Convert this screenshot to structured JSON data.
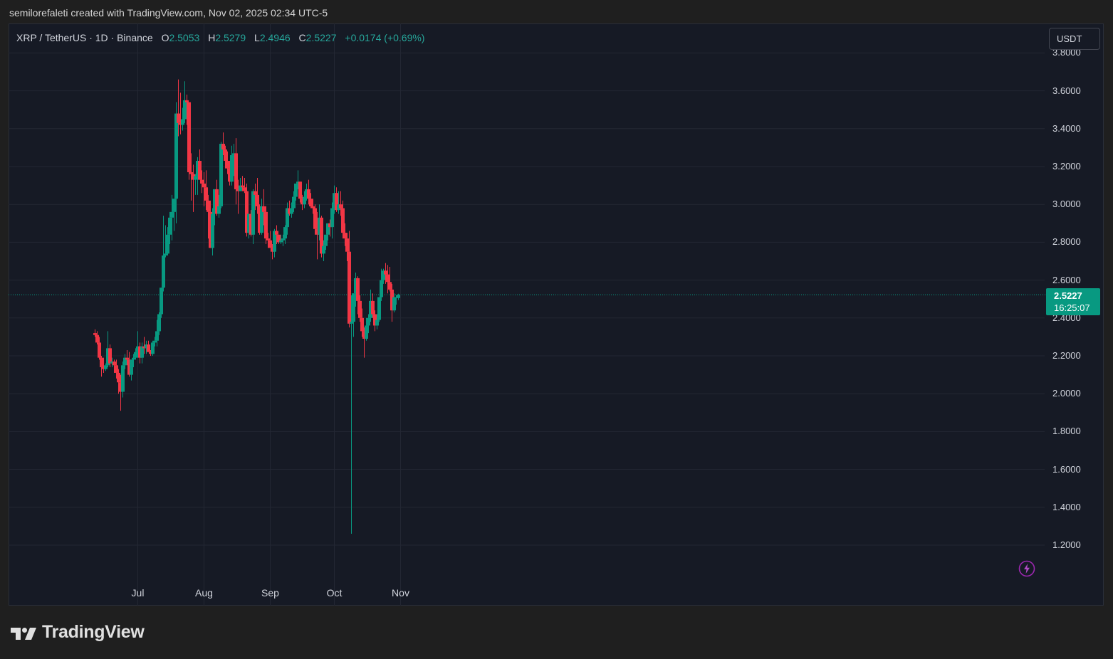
{
  "header": {
    "credit": "semilorefaleti created with TradingView.com, Nov 02, 2025 02:34 UTC-5"
  },
  "legend": {
    "symbol": "XRP / TetherUS · 1D · Binance",
    "open_label": "O",
    "open": "2.5053",
    "high_label": "H",
    "high": "2.5279",
    "low_label": "L",
    "low": "2.4946",
    "close_label": "C",
    "close": "2.5227",
    "change": "+0.0174 (+0.69%)"
  },
  "currency_button": "USDT",
  "price_tag": {
    "price": "2.5227",
    "countdown": "16:25:07"
  },
  "footer": {
    "brand": "TradingView"
  },
  "colors": {
    "up": "#089981",
    "down": "#f23645",
    "background": "#161a25",
    "grid": "#232733"
  },
  "icons": {
    "alert": "lightning-icon",
    "logo": "tradingview-logo-icon"
  },
  "chart_data": {
    "type": "candlestick",
    "symbol": "XRP / TetherUS",
    "interval": "1D",
    "exchange": "Binance",
    "y_axis": {
      "side": "right",
      "range": [
        1.05,
        3.86
      ],
      "ticks": [
        "3.8000",
        "3.6000",
        "3.4000",
        "3.2000",
        "3.0000",
        "2.8000",
        "2.6000",
        "2.4000",
        "2.2000",
        "2.0000",
        "1.8000",
        "1.6000",
        "1.4000",
        "1.2000"
      ]
    },
    "x_axis": {
      "ticks": [
        {
          "label": "Jul",
          "index": 20
        },
        {
          "label": "Aug",
          "index": 51
        },
        {
          "label": "Sep",
          "index": 82
        },
        {
          "label": "Oct",
          "index": 112
        },
        {
          "label": "Nov",
          "index": 143
        }
      ]
    },
    "grid": true,
    "last_price": 2.5227,
    "candles": [
      [
        2.32,
        2.34,
        2.3,
        2.31
      ],
      [
        2.31,
        2.33,
        2.26,
        2.27
      ],
      [
        2.27,
        2.3,
        2.18,
        2.19
      ],
      [
        2.19,
        2.2,
        2.09,
        2.14
      ],
      [
        2.14,
        2.19,
        2.11,
        2.13
      ],
      [
        2.13,
        2.16,
        2.12,
        2.15
      ],
      [
        2.15,
        2.33,
        2.14,
        2.24
      ],
      [
        2.24,
        2.26,
        2.14,
        2.16
      ],
      [
        2.16,
        2.19,
        2.14,
        2.17
      ],
      [
        2.17,
        2.18,
        2.11,
        2.15
      ],
      [
        2.15,
        2.18,
        2.08,
        2.11
      ],
      [
        2.11,
        2.13,
        2.0,
        2.06
      ],
      [
        2.06,
        2.1,
        1.91,
        2.01
      ],
      [
        2.01,
        2.17,
        1.98,
        2.15
      ],
      [
        2.15,
        2.21,
        2.13,
        2.19
      ],
      [
        2.19,
        2.23,
        2.15,
        2.18
      ],
      [
        2.18,
        2.22,
        2.09,
        2.1
      ],
      [
        2.1,
        2.18,
        2.07,
        2.18
      ],
      [
        2.18,
        2.21,
        2.14,
        2.19
      ],
      [
        2.19,
        2.24,
        2.18,
        2.22
      ],
      [
        2.22,
        2.33,
        2.19,
        2.25
      ],
      [
        2.25,
        2.27,
        2.16,
        2.19
      ],
      [
        2.19,
        2.27,
        2.16,
        2.25
      ],
      [
        2.25,
        2.3,
        2.21,
        2.24
      ],
      [
        2.24,
        2.28,
        2.21,
        2.26
      ],
      [
        2.26,
        2.28,
        2.22,
        2.22
      ],
      [
        2.22,
        2.23,
        2.2,
        2.21
      ],
      [
        2.21,
        2.28,
        2.2,
        2.27
      ],
      [
        2.27,
        2.3,
        2.25,
        2.28
      ],
      [
        2.28,
        2.39,
        2.25,
        2.33
      ],
      [
        2.33,
        2.43,
        2.31,
        2.42
      ],
      [
        2.42,
        2.56,
        2.4,
        2.56
      ],
      [
        2.56,
        2.94,
        2.54,
        2.73
      ],
      [
        2.73,
        2.89,
        2.72,
        2.74
      ],
      [
        2.74,
        2.88,
        2.73,
        2.84
      ],
      [
        2.84,
        2.96,
        2.79,
        2.93
      ],
      [
        2.93,
        3.05,
        2.81,
        2.96
      ],
      [
        2.96,
        3.03,
        2.86,
        3.03
      ],
      [
        3.03,
        3.54,
        2.9,
        3.48
      ],
      [
        3.48,
        3.66,
        3.36,
        3.43
      ],
      [
        3.43,
        3.59,
        3.37,
        3.42
      ],
      [
        3.42,
        3.51,
        3.39,
        3.45
      ],
      [
        3.45,
        3.65,
        3.43,
        3.55
      ],
      [
        3.55,
        3.58,
        3.42,
        3.54
      ],
      [
        3.54,
        3.54,
        3.13,
        3.17
      ],
      [
        3.17,
        3.27,
        3.02,
        3.16
      ],
      [
        3.16,
        3.21,
        2.96,
        3.13
      ],
      [
        3.13,
        3.16,
        3.05,
        3.15
      ],
      [
        3.15,
        3.25,
        3.05,
        3.23
      ],
      [
        3.23,
        3.29,
        3.13,
        3.13
      ],
      [
        3.13,
        3.18,
        3.06,
        3.11
      ],
      [
        3.11,
        3.17,
        2.99,
        3.09
      ],
      [
        3.09,
        3.18,
        2.97,
        3.02
      ],
      [
        3.02,
        3.05,
        2.82,
        2.96
      ],
      [
        2.96,
        3.02,
        2.77,
        2.77
      ],
      [
        2.77,
        2.98,
        2.73,
        2.95
      ],
      [
        2.95,
        3.08,
        2.89,
        3.08
      ],
      [
        3.08,
        3.13,
        2.94,
        2.95
      ],
      [
        2.95,
        3.05,
        2.93,
        2.99
      ],
      [
        2.99,
        3.33,
        2.98,
        3.32
      ],
      [
        3.32,
        3.38,
        3.26,
        3.29
      ],
      [
        3.29,
        3.31,
        3.19,
        3.23
      ],
      [
        3.23,
        3.28,
        3.16,
        3.19
      ],
      [
        3.19,
        3.23,
        3.1,
        3.12
      ],
      [
        3.12,
        3.31,
        3.1,
        3.26
      ],
      [
        3.26,
        3.32,
        3.15,
        3.27
      ],
      [
        3.27,
        3.35,
        3.0,
        3.08
      ],
      [
        3.08,
        3.13,
        2.95,
        3.07
      ],
      [
        3.07,
        3.14,
        3.07,
        3.1
      ],
      [
        3.1,
        3.15,
        3.07,
        3.09
      ],
      [
        3.09,
        3.14,
        3.06,
        3.07
      ],
      [
        3.07,
        3.11,
        2.83,
        2.85
      ],
      [
        2.85,
        2.95,
        2.82,
        2.95
      ],
      [
        2.95,
        2.97,
        2.83,
        2.84
      ],
      [
        2.84,
        3.08,
        2.79,
        3.07
      ],
      [
        3.07,
        3.11,
        2.97,
        3.05
      ],
      [
        3.05,
        3.14,
        2.95,
        2.99
      ],
      [
        2.99,
        3.0,
        2.84,
        2.85
      ],
      [
        2.85,
        3.03,
        2.84,
        2.99
      ],
      [
        2.99,
        3.08,
        2.89,
        2.96
      ],
      [
        2.96,
        2.99,
        2.79,
        2.82
      ],
      [
        2.82,
        2.85,
        2.77,
        2.81
      ],
      [
        2.81,
        2.86,
        2.77,
        2.77
      ],
      [
        2.77,
        2.79,
        2.71,
        2.75
      ],
      [
        2.75,
        2.87,
        2.72,
        2.86
      ],
      [
        2.86,
        2.89,
        2.79,
        2.84
      ],
      [
        2.84,
        2.84,
        2.79,
        2.8
      ],
      [
        2.8,
        2.84,
        2.79,
        2.81
      ],
      [
        2.81,
        2.84,
        2.78,
        2.82
      ],
      [
        2.82,
        2.89,
        2.79,
        2.88
      ],
      [
        2.88,
        3.01,
        2.84,
        2.98
      ],
      [
        2.98,
        3.02,
        2.94,
        2.95
      ],
      [
        2.95,
        3.01,
        2.93,
        2.98
      ],
      [
        2.98,
        3.07,
        2.96,
        3.04
      ],
      [
        3.04,
        3.11,
        3.02,
        3.11
      ],
      [
        3.11,
        3.18,
        3.08,
        3.12
      ],
      [
        3.12,
        3.12,
        3.01,
        3.03
      ],
      [
        3.03,
        3.05,
        2.97,
        3.0
      ],
      [
        3.0,
        3.07,
        2.98,
        3.04
      ],
      [
        3.04,
        3.11,
        3.02,
        3.08
      ],
      [
        3.08,
        3.13,
        3.0,
        3.03
      ],
      [
        3.03,
        3.06,
        2.98,
        2.99
      ],
      [
        2.99,
        3.03,
        2.95,
        2.98
      ],
      [
        2.98,
        3.0,
        2.84,
        2.87
      ],
      [
        2.87,
        2.96,
        2.71,
        2.84
      ],
      [
        2.84,
        3.0,
        2.81,
        2.93
      ],
      [
        2.93,
        2.94,
        2.72,
        2.74
      ],
      [
        2.74,
        2.81,
        2.7,
        2.78
      ],
      [
        2.78,
        2.84,
        2.76,
        2.84
      ],
      [
        2.84,
        2.9,
        2.81,
        2.9
      ],
      [
        2.9,
        2.92,
        2.83,
        2.88
      ],
      [
        2.88,
        3.01,
        2.82,
        2.98
      ],
      [
        2.98,
        3.1,
        2.95,
        3.06
      ],
      [
        3.06,
        3.09,
        2.96,
        2.97
      ],
      [
        2.97,
        3.07,
        2.95,
        3.0
      ],
      [
        3.0,
        3.07,
        2.94,
        2.98
      ],
      [
        2.98,
        3.02,
        2.82,
        2.85
      ],
      [
        2.85,
        2.9,
        2.78,
        2.82
      ],
      [
        2.82,
        2.85,
        2.7,
        2.75
      ],
      [
        2.75,
        2.86,
        2.35,
        2.37
      ],
      [
        2.37,
        2.52,
        1.26,
        2.38
      ],
      [
        2.38,
        2.53,
        2.3,
        2.53
      ],
      [
        2.53,
        2.64,
        2.46,
        2.61
      ],
      [
        2.61,
        2.62,
        2.42,
        2.49
      ],
      [
        2.49,
        2.52,
        2.38,
        2.4
      ],
      [
        2.4,
        2.45,
        2.3,
        2.33
      ],
      [
        2.33,
        2.35,
        2.19,
        2.29
      ],
      [
        2.29,
        2.4,
        2.28,
        2.36
      ],
      [
        2.36,
        2.42,
        2.32,
        2.4
      ],
      [
        2.4,
        2.55,
        2.38,
        2.49
      ],
      [
        2.49,
        2.53,
        2.4,
        2.42
      ],
      [
        2.42,
        2.44,
        2.33,
        2.36
      ],
      [
        2.36,
        2.42,
        2.34,
        2.39
      ],
      [
        2.39,
        2.5,
        2.38,
        2.51
      ],
      [
        2.51,
        2.66,
        2.49,
        2.6
      ],
      [
        2.6,
        2.66,
        2.58,
        2.65
      ],
      [
        2.65,
        2.69,
        2.58,
        2.63
      ],
      [
        2.63,
        2.68,
        2.53,
        2.59
      ],
      [
        2.59,
        2.67,
        2.54,
        2.55
      ],
      [
        2.55,
        2.58,
        2.38,
        2.44
      ],
      [
        2.44,
        2.53,
        2.43,
        2.51
      ],
      [
        2.51,
        2.52,
        2.47,
        2.51
      ],
      [
        2.5053,
        2.5279,
        2.4946,
        2.5227
      ]
    ]
  }
}
